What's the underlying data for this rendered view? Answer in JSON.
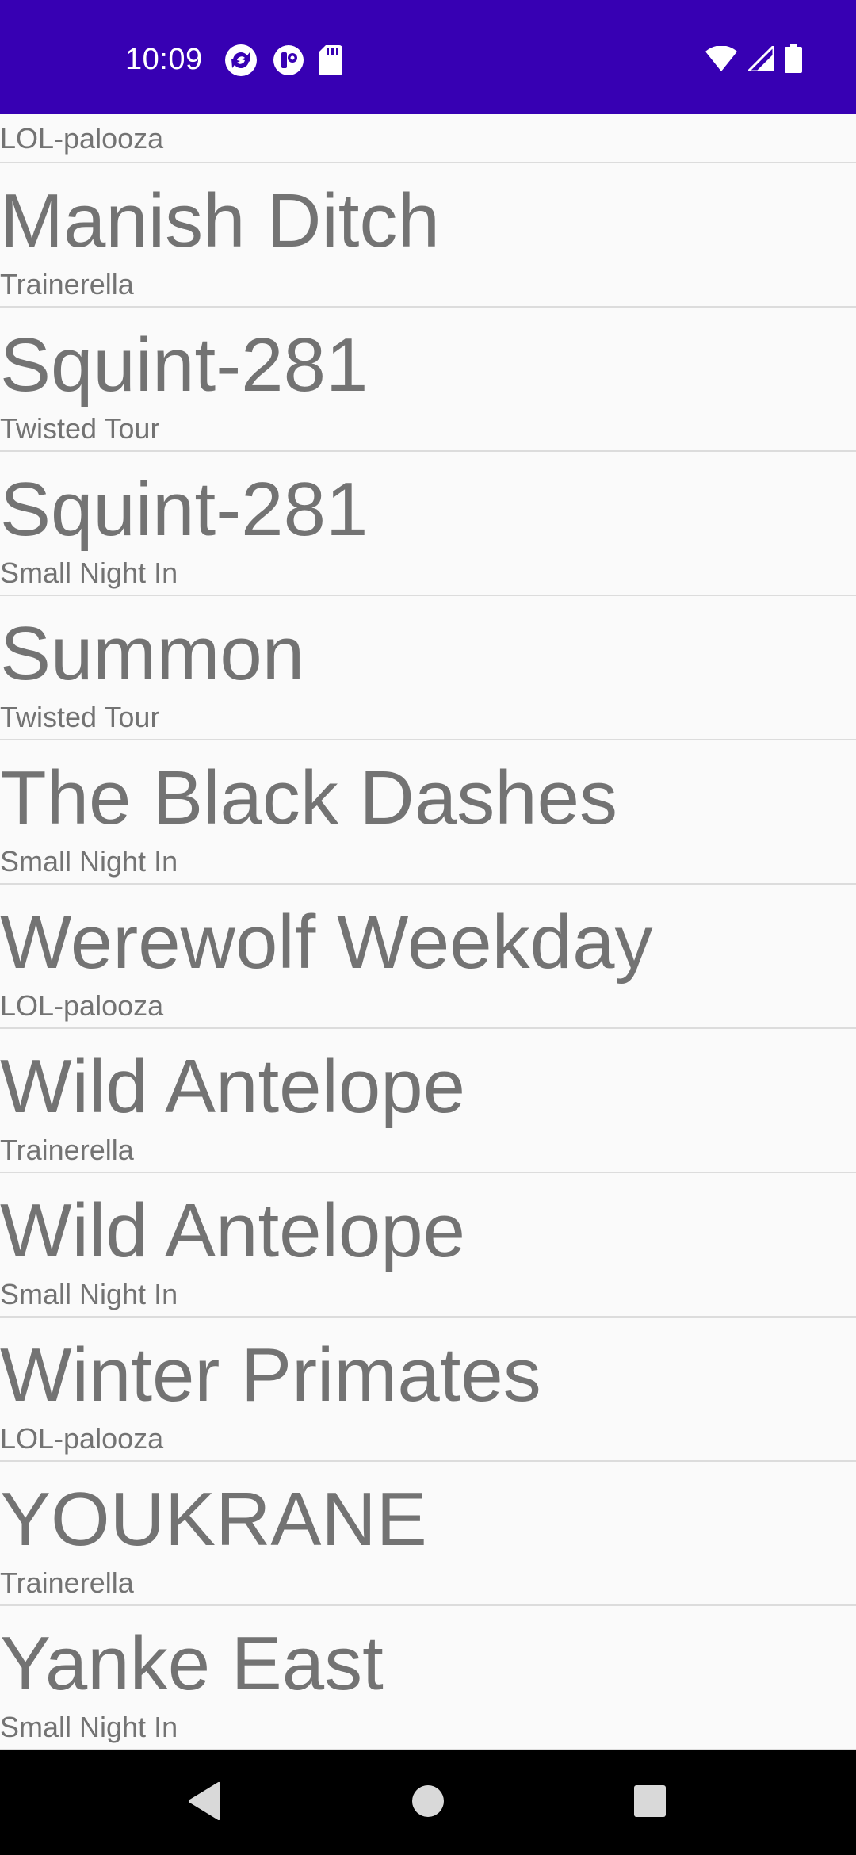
{
  "status_bar": {
    "time": "10:09",
    "background": "#3700b3",
    "left_icons": [
      "sync-icon",
      "pocket-icon",
      "sd-card-icon"
    ],
    "right_icons": [
      "wifi-icon",
      "cell-signal-icon",
      "battery-icon"
    ]
  },
  "list": {
    "partial_item": {
      "subtitle": "LOL-palooza"
    },
    "items": [
      {
        "title": "Manish Ditch",
        "subtitle": "Trainerella"
      },
      {
        "title": "Squint-281",
        "subtitle": "Twisted Tour"
      },
      {
        "title": "Squint-281",
        "subtitle": "Small Night In"
      },
      {
        "title": "Summon",
        "subtitle": "Twisted Tour"
      },
      {
        "title": "The Black Dashes",
        "subtitle": "Small Night In"
      },
      {
        "title": "Werewolf Weekday",
        "subtitle": "LOL-palooza"
      },
      {
        "title": "Wild Antelope",
        "subtitle": "Trainerella"
      },
      {
        "title": "Wild Antelope",
        "subtitle": "Small Night In"
      },
      {
        "title": "Winter Primates",
        "subtitle": "LOL-palooza"
      },
      {
        "title": "YOUKRANE",
        "subtitle": "Trainerella"
      },
      {
        "title": "Yanke East",
        "subtitle": "Small Night In"
      }
    ]
  },
  "nav_bar": {
    "buttons": [
      "back-icon",
      "home-icon",
      "recents-icon"
    ]
  }
}
